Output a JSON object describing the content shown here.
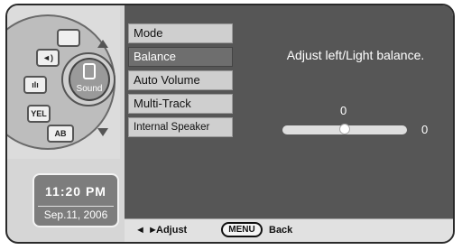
{
  "wheel": {
    "center_label": "Sound",
    "segment_labels": [
      "",
      "",
      "YEL",
      "AB"
    ]
  },
  "clock": {
    "time": "11:20 PM",
    "date": "Sep.11, 2006"
  },
  "menu": {
    "items": [
      {
        "label": "Mode"
      },
      {
        "label": "Balance"
      },
      {
        "label": "Auto Volume"
      },
      {
        "label": "Multi-Track"
      },
      {
        "label": "Internal Speaker"
      }
    ],
    "selected_index": 1
  },
  "main": {
    "description": "Adjust left/Light balance.",
    "balance_value_top": "0",
    "balance_value_right": "0",
    "slider_level": 0.5
  },
  "footer": {
    "arrows": "◄ ►",
    "adjust_label": "Adjust",
    "menu_button": "MENU",
    "back_label": "Back"
  },
  "colors": {
    "panel_bg": "#565656",
    "selected_item_bg": "#6e6e6e",
    "menu_item_bg": "#cfcfcf",
    "footer_bg": "#e1e1e1"
  }
}
